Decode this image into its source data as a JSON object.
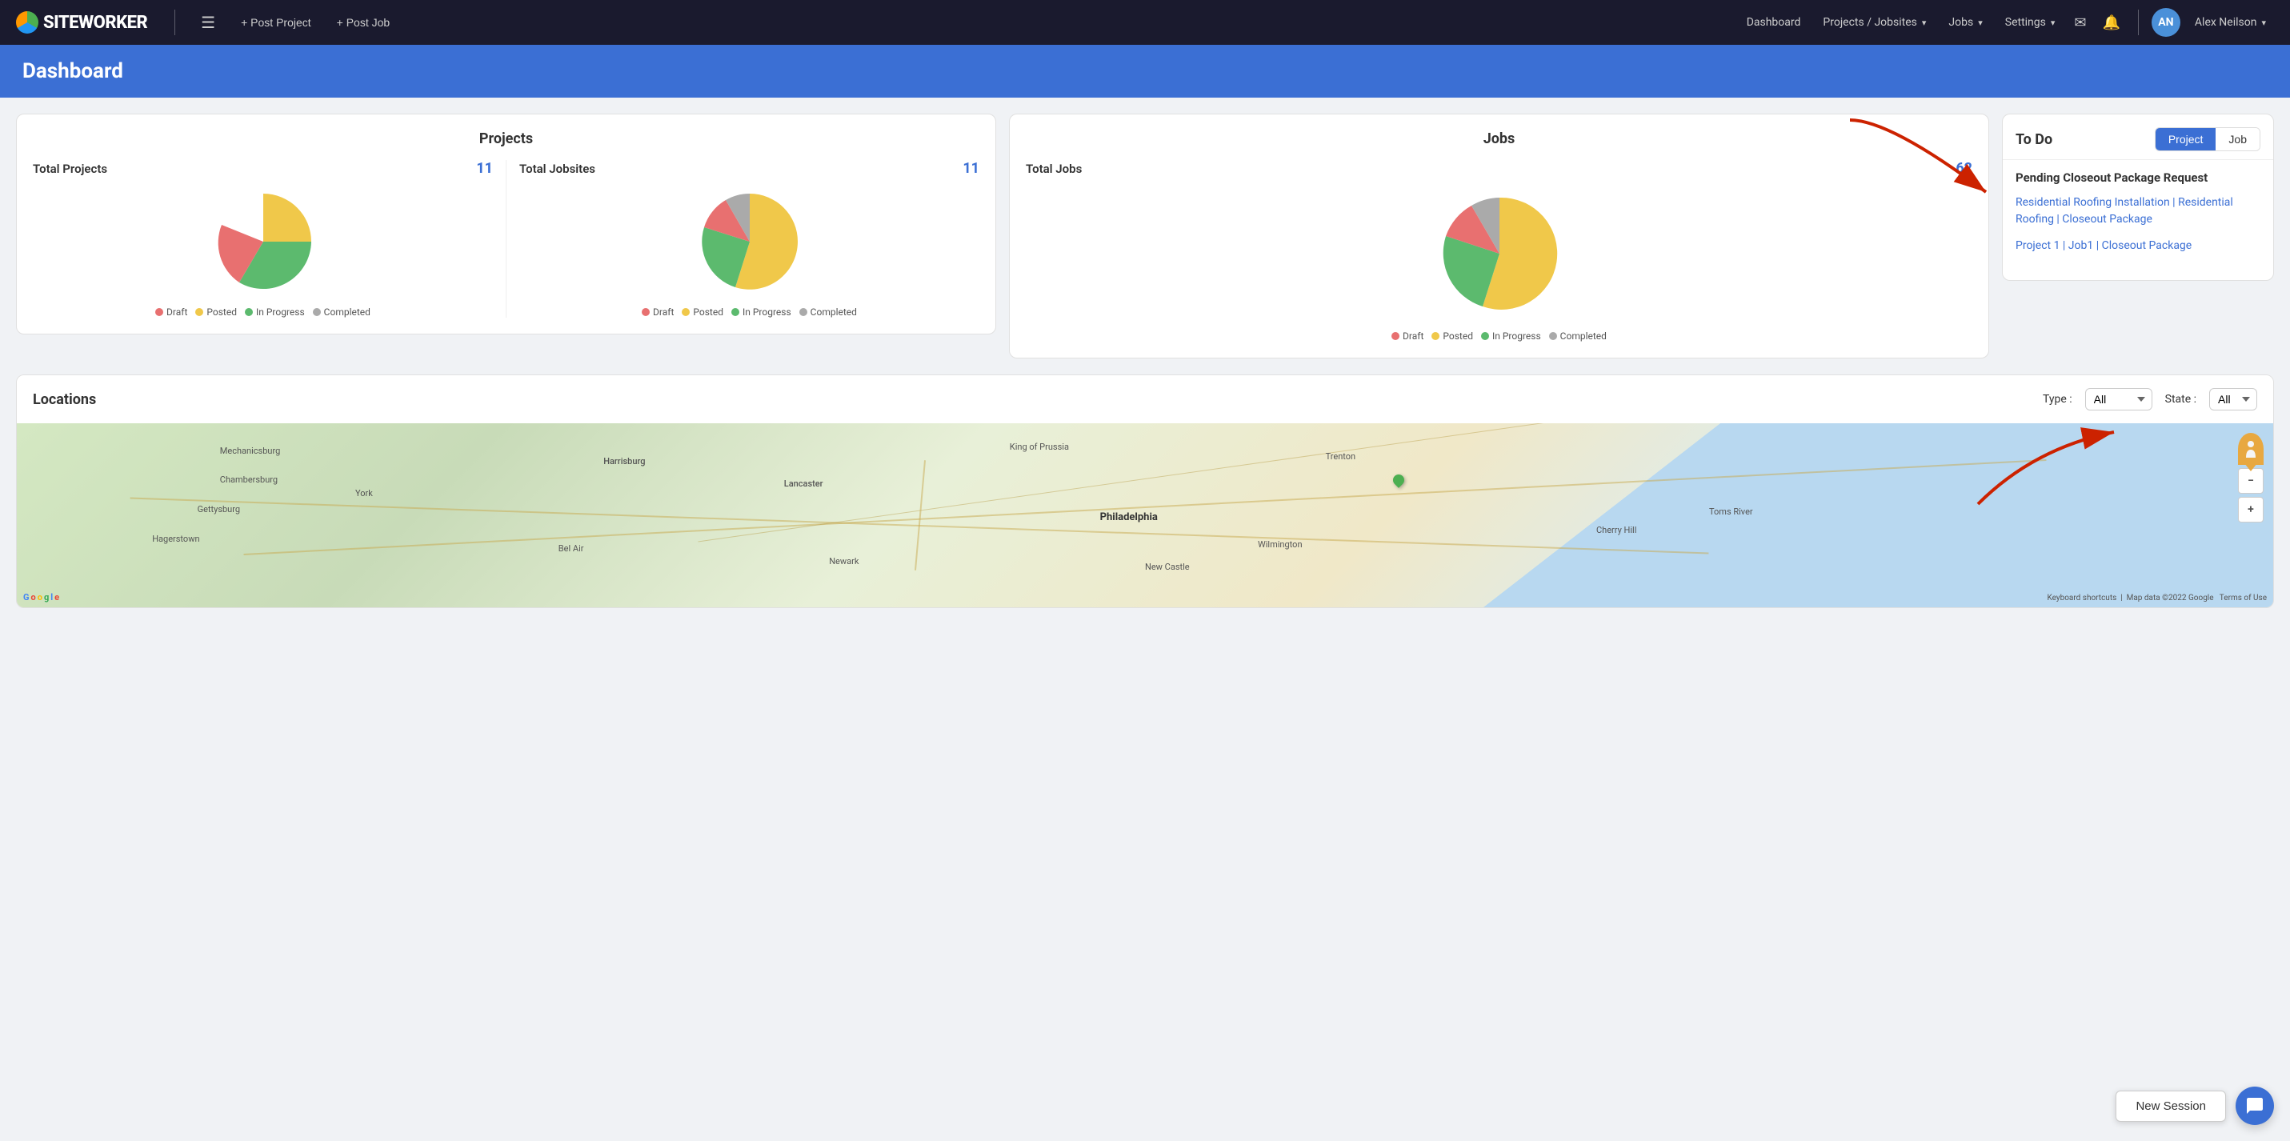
{
  "brand": {
    "name": "SITEWORKER"
  },
  "navbar": {
    "post_project": "+ Post Project",
    "post_job": "+ Post Job",
    "dashboard": "Dashboard",
    "projects_jobsites": "Projects / Jobsites",
    "jobs": "Jobs",
    "settings": "Settings",
    "user_initials": "AN",
    "user_name": "Alex Neilson"
  },
  "page": {
    "title": "Dashboard"
  },
  "projects_card": {
    "title": "Projects",
    "total_projects_label": "Total Projects",
    "total_projects_value": "11",
    "total_jobsites_label": "Total Jobsites",
    "total_jobsites_value": "11",
    "legend": [
      {
        "label": "Draft",
        "color": "#e87070"
      },
      {
        "label": "Posted",
        "color": "#f0c84a"
      },
      {
        "label": "In Progress",
        "color": "#5cba6e"
      },
      {
        "label": "Completed",
        "color": "#aaa"
      }
    ]
  },
  "jobs_card": {
    "title": "Jobs",
    "total_jobs_label": "Total Jobs",
    "total_jobs_value": "62",
    "legend": [
      {
        "label": "Draft",
        "color": "#e87070"
      },
      {
        "label": "Posted",
        "color": "#f0c84a"
      },
      {
        "label": "In Progress",
        "color": "#5cba6e"
      },
      {
        "label": "Completed",
        "color": "#aaa"
      }
    ]
  },
  "todo": {
    "title": "To Do",
    "tab_project": "Project",
    "tab_job": "Job",
    "section_title": "Pending Closeout Package Request",
    "links": [
      "Residential Roofing Installation | Residential Roofing | Closeout Package",
      "Project 1 | Job1 | Closeout Package"
    ]
  },
  "locations": {
    "title": "Locations",
    "type_label": "Type :",
    "type_value": "All",
    "state_label": "State :",
    "state_value": "All",
    "map_attribution": "Map data ©2022 Google",
    "keyboard_shortcuts": "Keyboard shortcuts",
    "terms": "Terms of Use"
  },
  "bottom": {
    "new_session": "New Session"
  }
}
